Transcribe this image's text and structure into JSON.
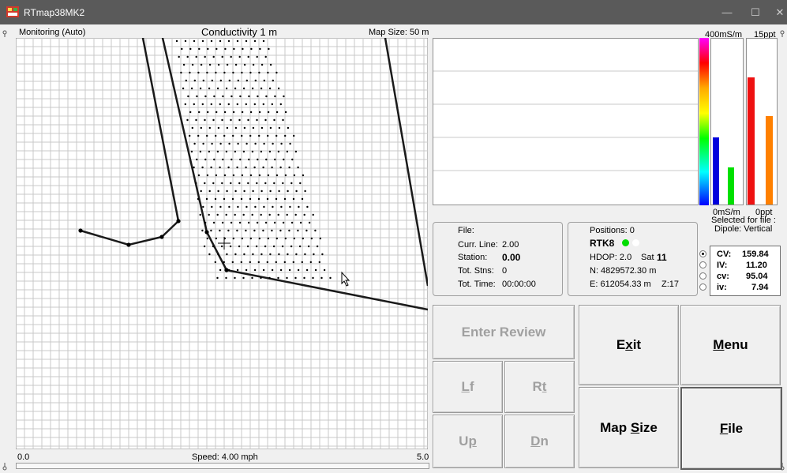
{
  "window": {
    "title": "RTmap38MK2"
  },
  "map": {
    "mode": "Monitoring (Auto)",
    "layer": "Conductivity 1 m",
    "map_size": "Map Size:  50 m",
    "scale_left": "0.0",
    "scale_right": "5.0",
    "speed": "Speed:  4.00 mph"
  },
  "gauges": {
    "top_left": "400mS/m",
    "top_right": "15ppt",
    "bottom_left": "0mS/m",
    "bottom_right": "0ppt",
    "selected_line1": "Selected for file :",
    "selected_line2": "Dipole: Vertical",
    "bar_levels": {
      "blue": 0.4,
      "green": 0.22,
      "red": 0.76,
      "orange": 0.53
    },
    "colors": {
      "blue": "#0000dd",
      "green": "#00e000",
      "red": "#ee1111",
      "orange": "#ff8000"
    }
  },
  "file_panel": {
    "file_label": "File:",
    "curr_line_label": "Curr. Line:",
    "curr_line_value": "2.00",
    "station_label": "Station:",
    "station_value": "0.00",
    "tot_stns_label": "Tot. Stns:",
    "tot_stns_value": "0",
    "tot_time_label": "Tot. Time:",
    "tot_time_value": "00:00:00"
  },
  "gps_panel": {
    "positions": "Positions:  0",
    "rtk": "RTK8",
    "hdop": "HDOP: 2.0",
    "sat_label": "Sat",
    "sat_value": "11",
    "north": "N:  4829572.30 m",
    "east": "E:  612054.33 m",
    "zone": "Z:17",
    "rtk_color": "#00dd00"
  },
  "readings": [
    {
      "label": "CV:",
      "value": "159.84",
      "selected": true
    },
    {
      "label": "IV:",
      "value": "11.20",
      "selected": false
    },
    {
      "label": "cv:",
      "value": "95.04",
      "selected": false
    },
    {
      "label": "iv:",
      "value": "7.94",
      "selected": false
    }
  ],
  "buttons": {
    "enter_review": "Enter Review",
    "exit_pre": "E",
    "exit_ul": "x",
    "exit_post": "it",
    "menu_ul": "M",
    "menu_post": "enu",
    "lf_ul": "L",
    "lf_post": "f",
    "rt_pre": "R",
    "rt_ul": "t",
    "up_pre": "U",
    "up_ul": "p",
    "dn_ul": "D",
    "dn_post": "n",
    "mapsize_pre": "Map ",
    "mapsize_ul": "S",
    "mapsize_post": "ize",
    "file_ul": "F",
    "file_post": "ile"
  }
}
